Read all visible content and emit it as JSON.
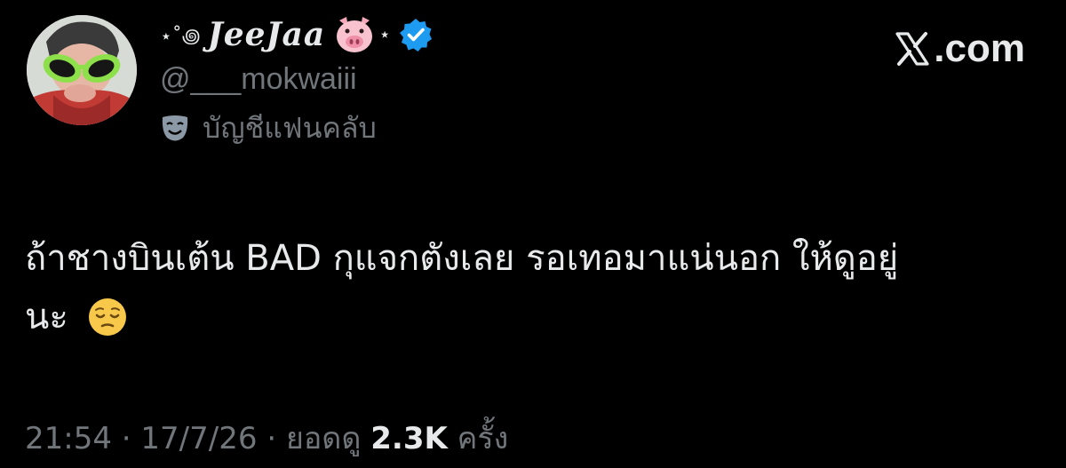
{
  "profile": {
    "display_name_prefix": "⋆˚꩜",
    "display_name": "JeeJaa",
    "display_name_suffix": "⋆",
    "handle": "@___mokwaiii",
    "account_label": "บัญชีแฟนคลับ",
    "avatar_icon": "profile-photo-green-alien-glasses",
    "name_icons": [
      "pig-face-icon",
      "verified-badge-icon"
    ],
    "label_icon": "theater-mask-icon"
  },
  "site": {
    "logo_text": ".com",
    "logo_icon": "x-logo-icon"
  },
  "tweet": {
    "text_line1": "ถ้าชางบินเต้น BAD กุแจกตังเลย รอเทอมาแน่นอก ให้ดูอยู่",
    "text_line2": "นะ",
    "emoji": "pensive-face-icon"
  },
  "meta": {
    "time": "21:54",
    "separator": "·",
    "date": "17/7/26",
    "views_prefix": "ยอดดู",
    "views_count": "2.3K",
    "views_suffix": "ครั้ง"
  },
  "colors": {
    "background": "#000000",
    "primary_text": "#e7e9ea",
    "secondary_text": "#71767b",
    "verified_badge": "#1d9bf0"
  }
}
